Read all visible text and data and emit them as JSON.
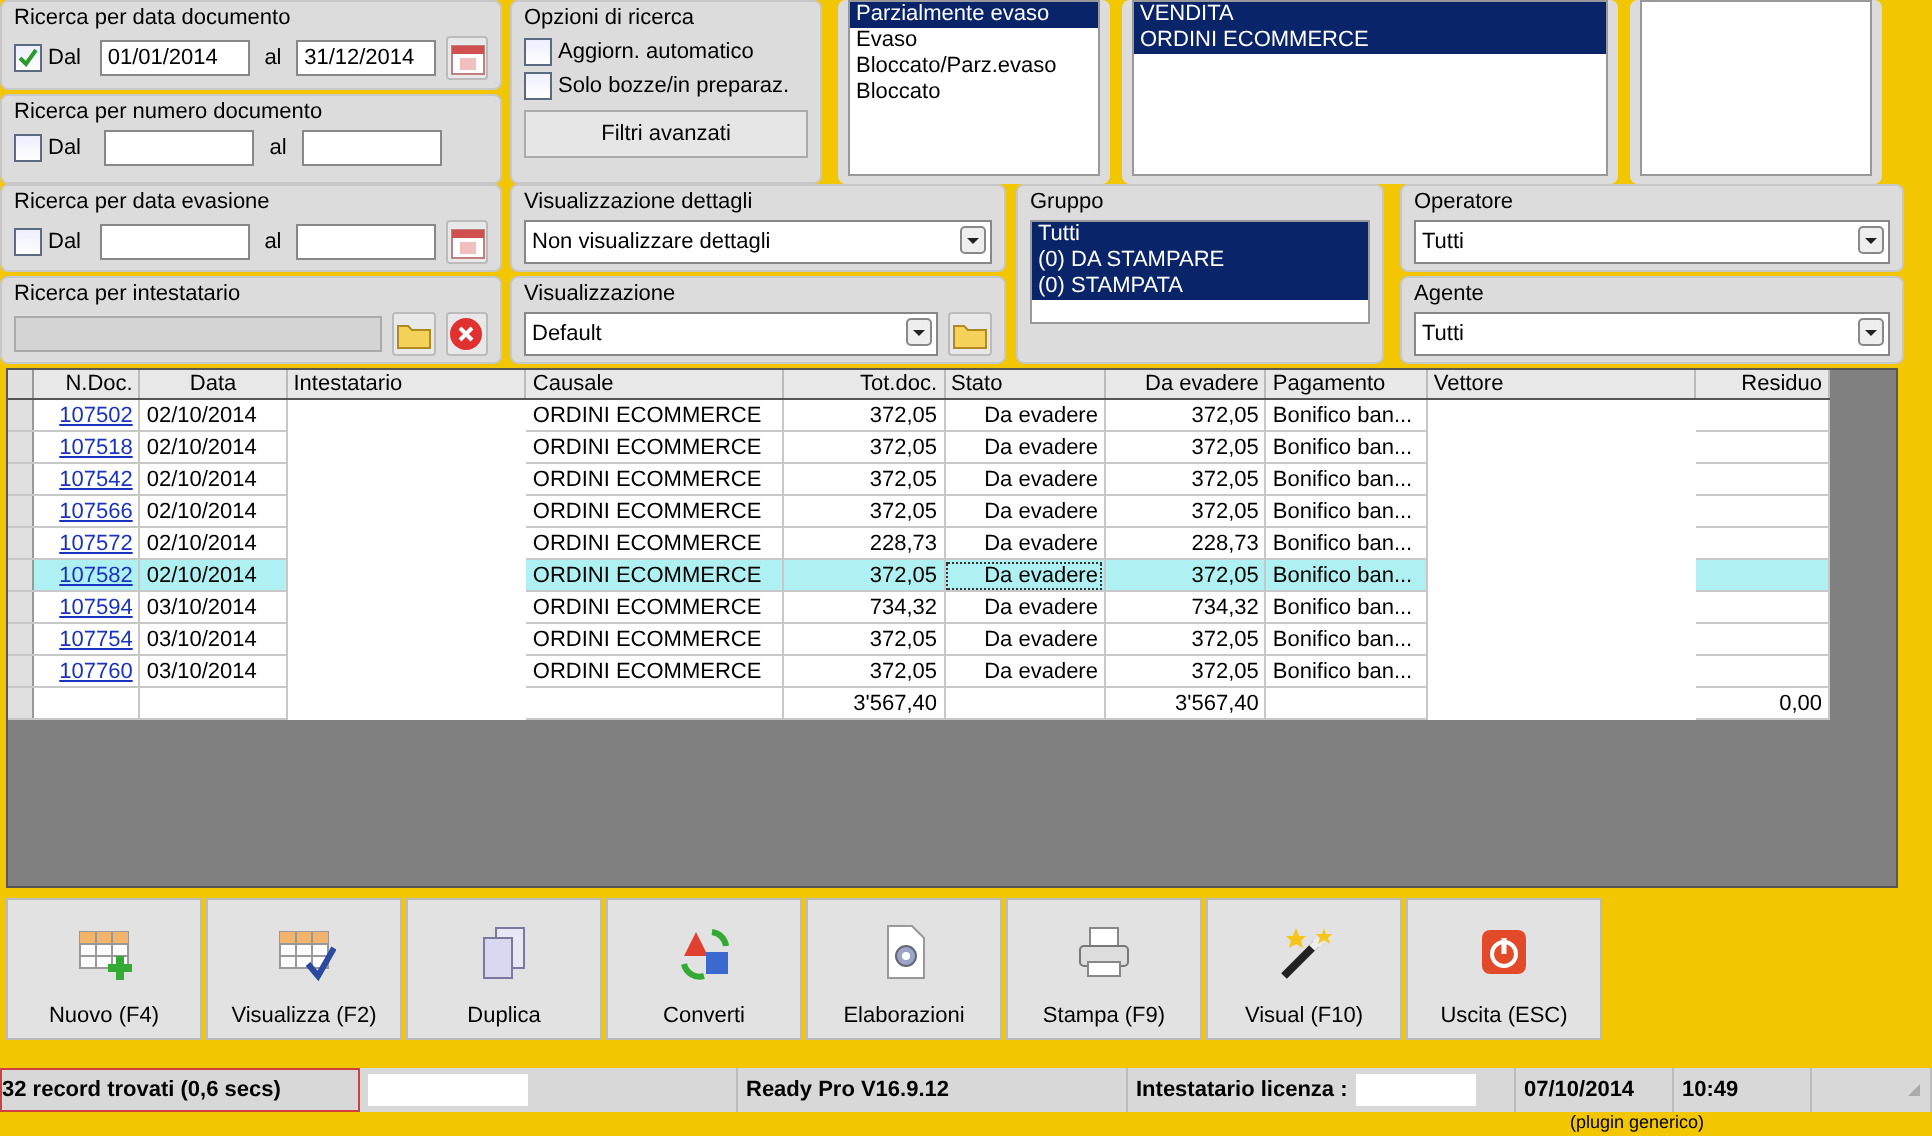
{
  "date_doc": {
    "title": "Ricerca per data documento",
    "checked": true,
    "from_label": "Dal",
    "from": "01/01/2014",
    "to_label": "al",
    "to": "31/12/2014"
  },
  "num_doc": {
    "title": "Ricerca per numero documento",
    "checked": false,
    "from_label": "Dal",
    "to_label": "al"
  },
  "date_eva": {
    "title": "Ricerca per data evasione",
    "checked": false,
    "from_label": "Dal",
    "to_label": "al"
  },
  "intestatario": {
    "title": "Ricerca per intestatario"
  },
  "options": {
    "title": "Opzioni di ricerca",
    "items": [
      {
        "label": "Aggiorn. automatico",
        "checked": false
      },
      {
        "label": "Solo bozze/in preparaz.",
        "checked": false
      }
    ],
    "button": "Filtri avanzati"
  },
  "status_list": [
    {
      "label": "Parzialmente evaso",
      "selected": true
    },
    {
      "label": "Evaso",
      "selected": false
    },
    {
      "label": "Bloccato/Parz.evaso",
      "selected": false
    },
    {
      "label": "Bloccato",
      "selected": false
    }
  ],
  "causale_list": [
    {
      "label": "VENDITA",
      "selected": true
    },
    {
      "label": "ORDINI ECOMMERCE",
      "selected": true
    }
  ],
  "dettagli": {
    "title": "Visualizzazione dettagli",
    "value": "Non visualizzare dettagli"
  },
  "visualizzazione": {
    "title": "Visualizzazione",
    "value": "Default"
  },
  "gruppo": {
    "title": "Gruppo",
    "items": [
      {
        "label": "Tutti",
        "selected": true
      },
      {
        "label": "(0) DA STAMPARE",
        "selected": true
      },
      {
        "label": "(0) STAMPATA",
        "selected": true
      }
    ]
  },
  "operatore": {
    "title": "Operatore",
    "value": "Tutti"
  },
  "agente": {
    "title": "Agente",
    "value": "Tutti"
  },
  "table": {
    "columns": [
      {
        "label": "N.Doc.",
        "kind": "link"
      },
      {
        "label": "Data",
        "kind": "text"
      },
      {
        "label": "Intestatario",
        "kind": "masked"
      },
      {
        "label": "Causale",
        "kind": "text"
      },
      {
        "label": "Tot.doc.",
        "kind": "num"
      },
      {
        "label": "Stato",
        "kind": "num"
      },
      {
        "label": "Da evadere",
        "kind": "num"
      },
      {
        "label": "Pagamento",
        "kind": "text"
      },
      {
        "label": "Vettore",
        "kind": "masked"
      },
      {
        "label": "Residuo",
        "kind": "num"
      }
    ],
    "rows": [
      {
        "selected": false,
        "cells": [
          "107502",
          "02/10/2014",
          null,
          "ORDINI ECOMMERCE",
          "372,05",
          "Da evadere",
          "372,05",
          "Bonifico ban...",
          null,
          null
        ]
      },
      {
        "selected": false,
        "cells": [
          "107518",
          "02/10/2014",
          null,
          "ORDINI ECOMMERCE",
          "372,05",
          "Da evadere",
          "372,05",
          "Bonifico ban...",
          null,
          null
        ]
      },
      {
        "selected": false,
        "cells": [
          "107542",
          "02/10/2014",
          null,
          "ORDINI ECOMMERCE",
          "372,05",
          "Da evadere",
          "372,05",
          "Bonifico ban...",
          null,
          null
        ]
      },
      {
        "selected": false,
        "cells": [
          "107566",
          "02/10/2014",
          null,
          "ORDINI ECOMMERCE",
          "372,05",
          "Da evadere",
          "372,05",
          "Bonifico ban...",
          null,
          null
        ]
      },
      {
        "selected": false,
        "cells": [
          "107572",
          "02/10/2014",
          null,
          "ORDINI ECOMMERCE",
          "228,73",
          "Da evadere",
          "228,73",
          "Bonifico ban...",
          null,
          null
        ]
      },
      {
        "selected": true,
        "cells": [
          "107582",
          "02/10/2014",
          null,
          "ORDINI ECOMMERCE",
          "372,05",
          "Da evadere",
          "372,05",
          "Bonifico ban...",
          null,
          null
        ]
      },
      {
        "selected": false,
        "cells": [
          "107594",
          "03/10/2014",
          null,
          "ORDINI ECOMMERCE",
          "734,32",
          "Da evadere",
          "734,32",
          "Bonifico ban...",
          null,
          null
        ]
      },
      {
        "selected": false,
        "cells": [
          "107754",
          "03/10/2014",
          null,
          "ORDINI ECOMMERCE",
          "372,05",
          "Da evadere",
          "372,05",
          "Bonifico ban...",
          null,
          null
        ]
      },
      {
        "selected": false,
        "cells": [
          "107760",
          "03/10/2014",
          null,
          "ORDINI ECOMMERCE",
          "372,05",
          "Da evadere",
          "372,05",
          "Bonifico ban...",
          null,
          null
        ]
      }
    ],
    "totals": {
      "tot_doc": "3'567,40",
      "da_evadere": "3'567,40",
      "residuo": "0,00"
    }
  },
  "buttons": [
    {
      "label": "Nuovo (F4)",
      "kind": "new"
    },
    {
      "label": "Visualizza (F2)",
      "kind": "view"
    },
    {
      "label": "Duplica",
      "kind": "duplicate"
    },
    {
      "label": "Converti",
      "kind": "convert"
    },
    {
      "label": "Elaborazioni",
      "kind": "process"
    },
    {
      "label": "Stampa (F9)",
      "kind": "print"
    },
    {
      "label": "Visual (F10)",
      "kind": "wand"
    },
    {
      "label": "Uscita (ESC)",
      "kind": "exit"
    }
  ],
  "status_bar": {
    "records": "32 record trovati (0,6 secs)",
    "version": "Ready Pro V16.9.12",
    "license_label": "Intestatario licenza :",
    "date": "07/10/2014",
    "time": "10:49",
    "note": "(plugin generico)"
  }
}
